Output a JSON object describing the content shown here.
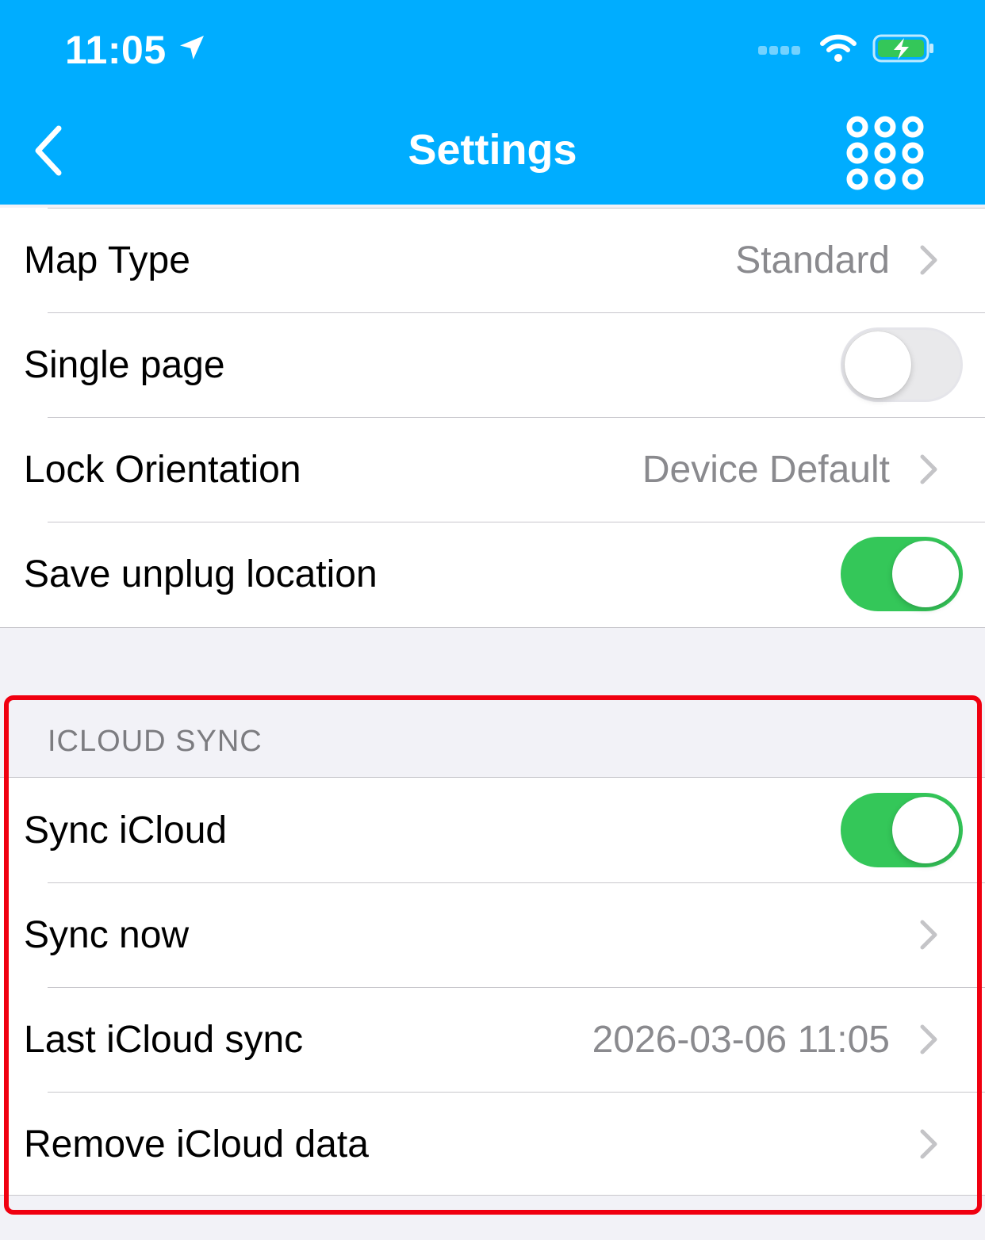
{
  "status_bar": {
    "time": "11:05"
  },
  "nav": {
    "title": "Settings"
  },
  "general_rows": [
    {
      "label": "Map Type",
      "value": "Standard"
    },
    {
      "label": "Single page",
      "toggle": false
    },
    {
      "label": "Lock Orientation",
      "value": "Device Default"
    },
    {
      "label": "Save unplug location",
      "toggle": true
    }
  ],
  "icloud_section": {
    "header": "ICLOUD SYNC",
    "rows": [
      {
        "label": "Sync iCloud",
        "toggle": true
      },
      {
        "label": "Sync now"
      },
      {
        "label": "Last iCloud sync",
        "value": "2026-03-06 11:05"
      },
      {
        "label": "Remove iCloud data"
      }
    ]
  },
  "colors": {
    "nav_background": "#00adff",
    "toggle_on": "#34c759",
    "highlight": "#f00010"
  }
}
